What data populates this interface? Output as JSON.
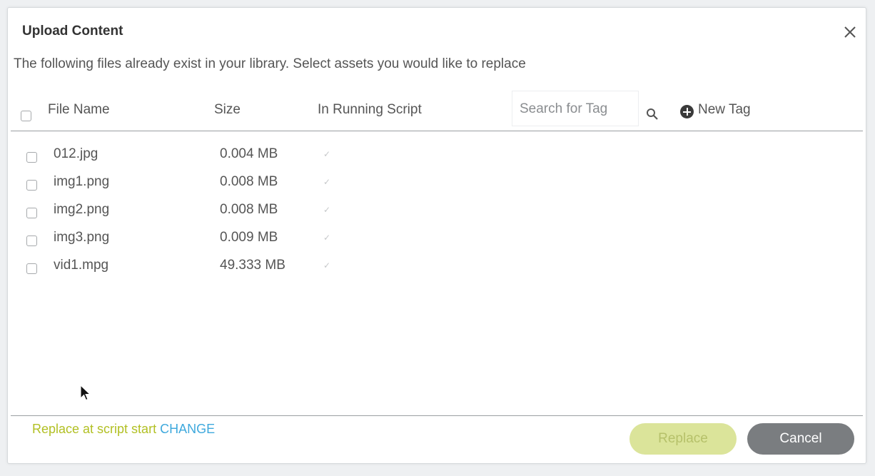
{
  "dialog": {
    "title": "Upload Content",
    "subtitle": "The following files already exist in your library. Select assets you would like to replace"
  },
  "table": {
    "columns": {
      "file_name": "File Name",
      "size": "Size",
      "in_running_script": "In Running Script"
    },
    "search_placeholder": "Search for Tag",
    "new_tag_label": "New Tag",
    "rows": [
      {
        "file": "012.jpg",
        "size": "0.004 MB",
        "in_running_script": "✓"
      },
      {
        "file": "img1.png",
        "size": "0.008 MB",
        "in_running_script": "✓"
      },
      {
        "file": "img2.png",
        "size": "0.008 MB",
        "in_running_script": "✓"
      },
      {
        "file": "img3.png",
        "size": "0.009 MB",
        "in_running_script": "✓"
      },
      {
        "file": "vid1.mpg",
        "size": "49.333 MB",
        "in_running_script": "✓"
      }
    ]
  },
  "footer": {
    "replace_note": "Replace at script start",
    "change_link": "CHANGE",
    "replace_button": "Replace",
    "cancel_button": "Cancel"
  },
  "colors": {
    "accent_green": "#b2c024",
    "link_blue": "#3fa9dd",
    "cancel_gray": "#7a7d80"
  },
  "icons": [
    "close-icon",
    "search-icon",
    "plus-circle-icon",
    "mouse-cursor-icon"
  ]
}
